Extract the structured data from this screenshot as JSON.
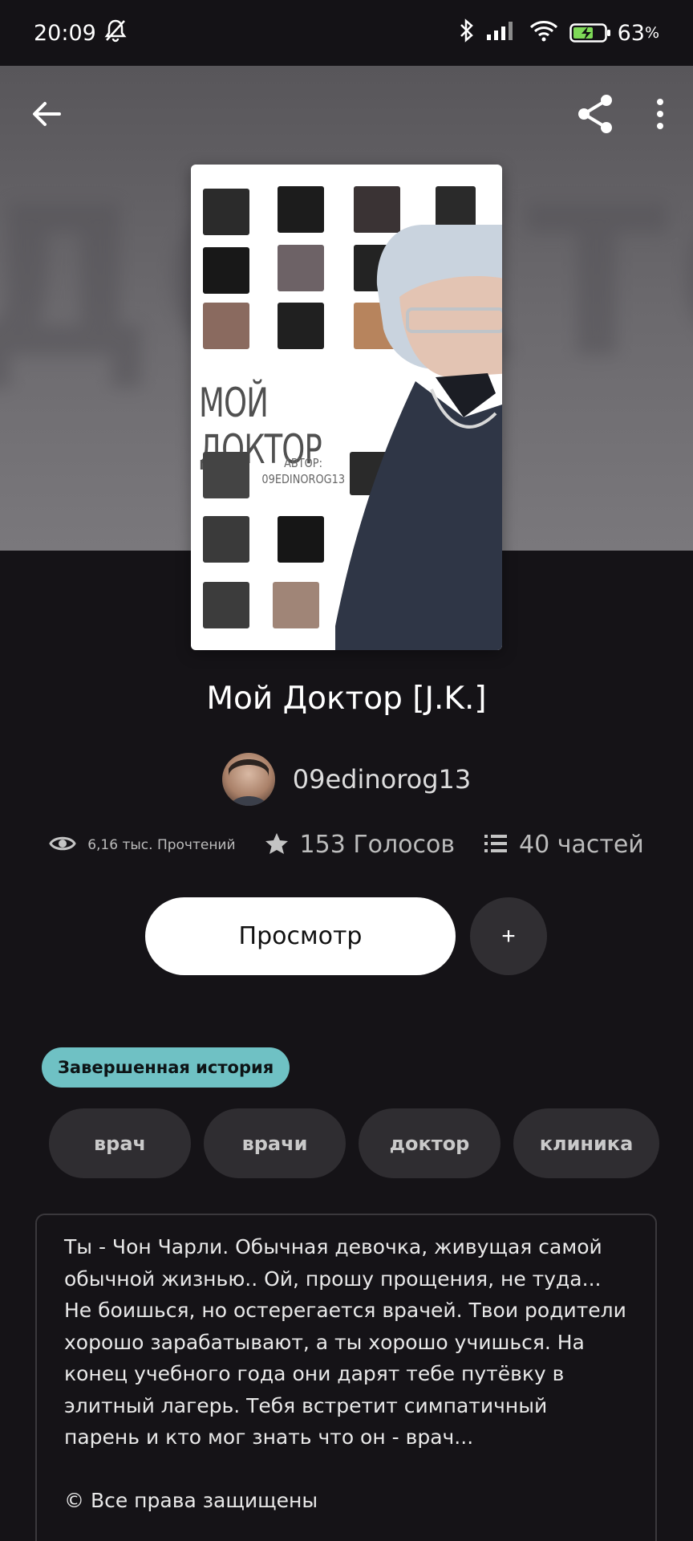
{
  "status_bar": {
    "time": "20:09",
    "battery": "63"
  },
  "cover": {
    "title": "МОЙ ДОКТОР",
    "author_label": "АВТОР:",
    "author_name": "09EDINOROG13"
  },
  "book": {
    "title": "Мой Доктор [J.K.]",
    "author": "09edinorog13"
  },
  "stats": {
    "reads": "6,16 тыс. Прочтений",
    "votes": "153 Голосов",
    "parts": "40 частей"
  },
  "actions": {
    "read_label": "Просмотр",
    "add_label": "+"
  },
  "status_tag": "Завершенная история",
  "tags": [
    "врач",
    "врачи",
    "доктор",
    "клиника"
  ],
  "description": {
    "text": "Ты - Чон Чарли. Обычная девочка, живущая самой обычной жизнью.. Ой, прошу прощения, не туда... Не боишься, но остерегается врачей. Твои родители хорошо зарабатывают, а ты хорошо учишься.  На конец учебного года они дарят тебе путёвку в элитный лагерь. Тебя встретит симпатичный парень и кто мог знать что он - врач...",
    "copyright": "© Все права защищены"
  },
  "colors": {
    "background": "#151317",
    "badge": "#6fc1c4",
    "chip": "#2f2d31"
  }
}
